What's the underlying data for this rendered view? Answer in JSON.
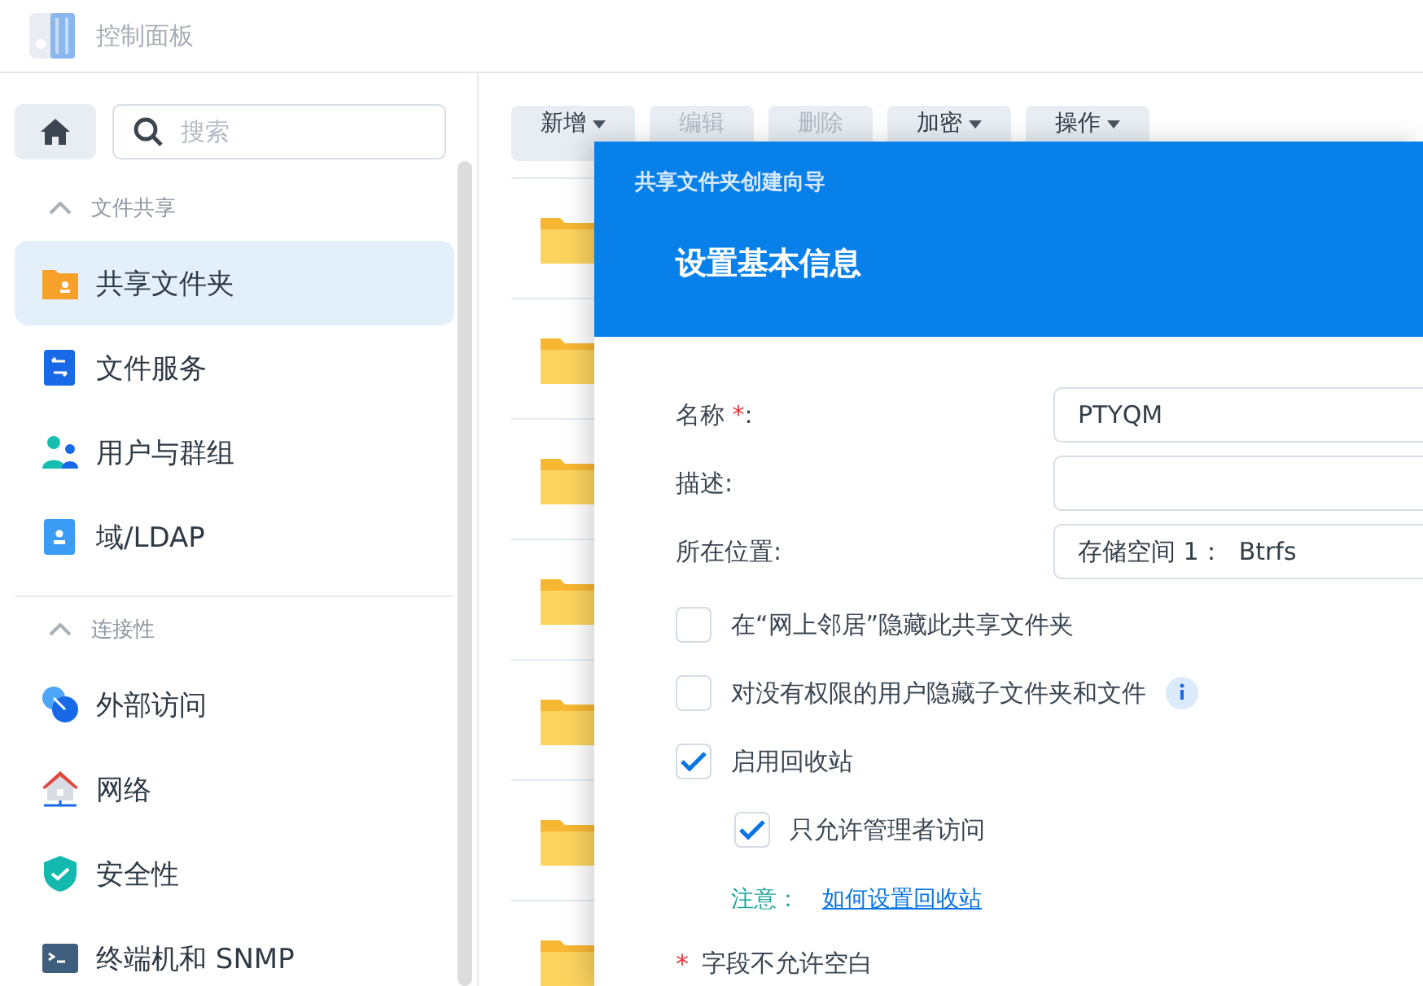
{
  "window": {
    "title": "控制面板"
  },
  "sidebar": {
    "search": {
      "placeholder": "搜索"
    },
    "sections": [
      {
        "title": "文件共享",
        "expanded": true,
        "items": [
          {
            "label": "共享文件夹",
            "kind": "folder",
            "selected": true
          },
          {
            "label": "文件服务",
            "kind": "transfer",
            "selected": false
          },
          {
            "label": "用户与群组",
            "kind": "users",
            "selected": false
          },
          {
            "label": "域/LDAP",
            "kind": "card",
            "selected": false
          }
        ]
      },
      {
        "title": "连接性",
        "expanded": true,
        "items": [
          {
            "label": "外部访问",
            "kind": "globe",
            "selected": false
          },
          {
            "label": "网络",
            "kind": "house",
            "selected": false
          },
          {
            "label": "安全性",
            "kind": "shield",
            "selected": false
          },
          {
            "label": "终端机和 SNMP",
            "kind": "terminal",
            "selected": false
          }
        ]
      }
    ]
  },
  "toolbar": [
    {
      "label": "新增",
      "dropdown": true,
      "disabled": false
    },
    {
      "label": "编辑",
      "dropdown": false,
      "disabled": true
    },
    {
      "label": "删除",
      "dropdown": false,
      "disabled": true
    },
    {
      "label": "加密",
      "dropdown": true,
      "disabled": false
    },
    {
      "label": "操作",
      "dropdown": true,
      "disabled": false
    }
  ],
  "folders": [
    {
      "kind": "folder"
    },
    {
      "kind": "folder"
    },
    {
      "kind": "folder"
    },
    {
      "kind": "folder"
    },
    {
      "kind": "folder"
    },
    {
      "kind": "folder"
    },
    {
      "kind": "folder"
    }
  ],
  "dialog": {
    "title": "共享文件夹创建向导",
    "step": "设置基本信息",
    "fields": [
      {
        "label": "名称",
        "required": true,
        "colon": ":",
        "value": "PTYQM"
      },
      {
        "label": "描述",
        "required": false,
        "colon": ":"
      },
      {
        "label": "所在位置",
        "required": false,
        "colon": ":",
        "value": "存储空间 1：  Btrfs"
      }
    ],
    "options": [
      {
        "label": "在“网上邻居”隐藏此共享文件夹",
        "checked": false,
        "info": false
      },
      {
        "label": "对没有权限的用户隐藏子文件夹和文件",
        "checked": false,
        "info": true
      },
      {
        "label": "启用回收站",
        "checked": true,
        "info": false,
        "children": [
          {
            "label": "只允许管理者访问",
            "checked": true,
            "info": false
          }
        ]
      }
    ],
    "note": {
      "label": "注意：",
      "link": "如何设置回收站"
    },
    "required_mark": "*",
    "footer": "字段不允许空白"
  }
}
